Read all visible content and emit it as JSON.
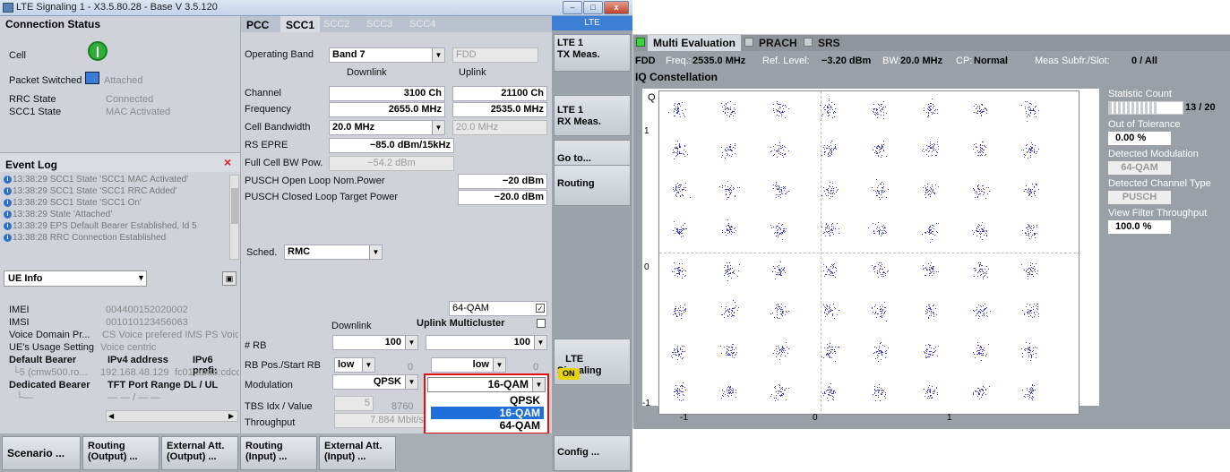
{
  "window": {
    "title": "LTE Signaling 1 - X3.5.80.28 - Base V 3.5.120",
    "btn_min": "–",
    "btn_max": "□",
    "btn_close": "x"
  },
  "left": {
    "connection_status_title": "Connection Status",
    "cell_label": "Cell",
    "packet_switched_label": "Packet Switched",
    "packet_switched_value": "Attached",
    "rrc_state_label": "RRC State",
    "rrc_state_value": "Connected",
    "scc1_state_label": "SCC1 State",
    "scc1_state_value": "MAC Activated",
    "event_log_title": "Event Log",
    "event_log_close": "×",
    "events": [
      "13:38:29 SCC1 State 'SCC1 MAC Activated'",
      "13:38:29 SCC1 State 'SCC1 RRC Added'",
      "13:38:29 SCC1 State 'SCC1 On'",
      "13:38:29 State 'Attached'",
      "13:38:29 EPS Default Bearer Established, Id 5",
      "13:38:28 RRC Connection Established"
    ],
    "ue_info_select": "UE Info",
    "imei_label": "IMEI",
    "imei_value": "004400152020002",
    "imsi_label": "IMSI",
    "imsi_value": "001010123456063",
    "voice_domain_label": "Voice Domain Pr...",
    "voice_domain_value": "CS Voice prefered IMS PS Voic",
    "usage_label": "UE's Usage Setting",
    "usage_value": "Voice centric",
    "default_bearer_label": "Default Bearer",
    "ipv4_label": "IPv4 address",
    "ipv6_label": "IPv6 prefi:",
    "bearer_row": "└5 (cmw500.ro...",
    "bearer_ipv4": "192.168.48.129",
    "bearer_ipv6": "fc01:abab:cdcc",
    "dedicated_label": "Dedicated Bearer",
    "tft_label": "TFT Port Range DL / UL",
    "dedicated_row": "└—",
    "dedicated_row_val": "— — / — —"
  },
  "center": {
    "tabs": [
      "PCC",
      "SCC1",
      "SCC2",
      "SCC3",
      "SCC4"
    ],
    "operating_band_label": "Operating Band",
    "operating_band_value": "Band 7",
    "duplex_value": "FDD",
    "downlink_hdr": "Downlink",
    "uplink_hdr": "Uplink",
    "channel_label": "Channel",
    "channel_dl": "3100 Ch",
    "channel_ul": "21100 Ch",
    "frequency_label": "Frequency",
    "freq_dl": "2655.0 MHz",
    "freq_ul": "2535.0 MHz",
    "bw_label": "Cell Bandwidth",
    "bw_dl": "20.0 MHz",
    "bw_ul": "20.0 MHz",
    "rs_epre_label": "RS EPRE",
    "rs_epre_value": "−85.0 dBm/15kHz",
    "full_cell_label": "Full Cell BW Pow.",
    "full_cell_value": "−54.2 dBm",
    "pusch_ol_label": "PUSCH Open Loop Nom.Power",
    "pusch_ol_value": "−20 dBm",
    "pusch_cl_label": "PUSCH Closed Loop Target Power",
    "pusch_cl_value": "−20.0 dBm",
    "sched_label": "Sched.",
    "sched_value": "RMC",
    "qam64_value": "64-QAM",
    "downlink_hdr2": "Downlink",
    "uplink_multicluster": "Uplink Multicluster",
    "rb_label": "# RB",
    "rb_dl": "100",
    "rb_ul": "100",
    "rbpos_label": "RB Pos./Start RB",
    "rbpos_dl": "low",
    "rbpos_dl_start": "0",
    "rbpos_ul": "low",
    "rbpos_ul_start": "0",
    "mod_label": "Modulation",
    "mod_dl": "QPSK",
    "mod_ul": "16-QAM",
    "tbs_label": "TBS Idx / Value",
    "tbs_idx": "5",
    "tbs_value": "8760",
    "throughput_label": "Throughput",
    "throughput_value": "7.884 Mbit/s",
    "dropdown_options": [
      "QPSK",
      "16-QAM",
      "64-QAM"
    ],
    "dropdown_selected": "16-QAM"
  },
  "softkeys": {
    "lte": "LTE",
    "tx": "LTE 1\nTX Meas.",
    "rx": "LTE 1\nRX Meas.",
    "goto": "Go to...",
    "routing": "Routing",
    "signaling": "LTE\nSignaling",
    "on": "ON",
    "config": "Config ..."
  },
  "bottom": {
    "scenario": "Scenario ...",
    "routing_out": "Routing\n(Output) ...",
    "ext_out": "External Att.\n(Output) ...",
    "routing_in": "Routing\n(Input) ...",
    "ext_in": "External Att.\n(Input) ..."
  },
  "right": {
    "tabs": [
      "Multi Evaluation",
      "PRACH",
      "SRS"
    ],
    "info": {
      "fdd": "FDD",
      "freq_label": "Freq.:",
      "freq": "2535.0 MHz",
      "ref_label": "Ref. Level:",
      "ref": "−3.20 dBm",
      "bw_label": "BW:",
      "bw": "20.0 MHz",
      "cp_label": "CP:",
      "cp": "Normal",
      "meas_label": "Meas Subfr./Slot:",
      "meas": "0 / All"
    },
    "iq_title": "IQ Constellation",
    "q_label": "Q",
    "y_ticks": [
      "1",
      "0",
      "-1"
    ],
    "x_ticks": [
      "-1",
      "0",
      "1"
    ],
    "stat_count_label": "Statistic Count",
    "stat_count_value": "13 / 20",
    "stat_count_fraction": 0.65,
    "oot_label": "Out of Tolerance",
    "oot_value": "0.00 %",
    "det_mod_label": "Detected Modulation",
    "det_mod_value": "64-QAM",
    "det_ch_label": "Detected Channel Type",
    "det_ch_value": "PUSCH",
    "vft_label": "View Filter Throughput",
    "vft_value": "100.0 %"
  }
}
